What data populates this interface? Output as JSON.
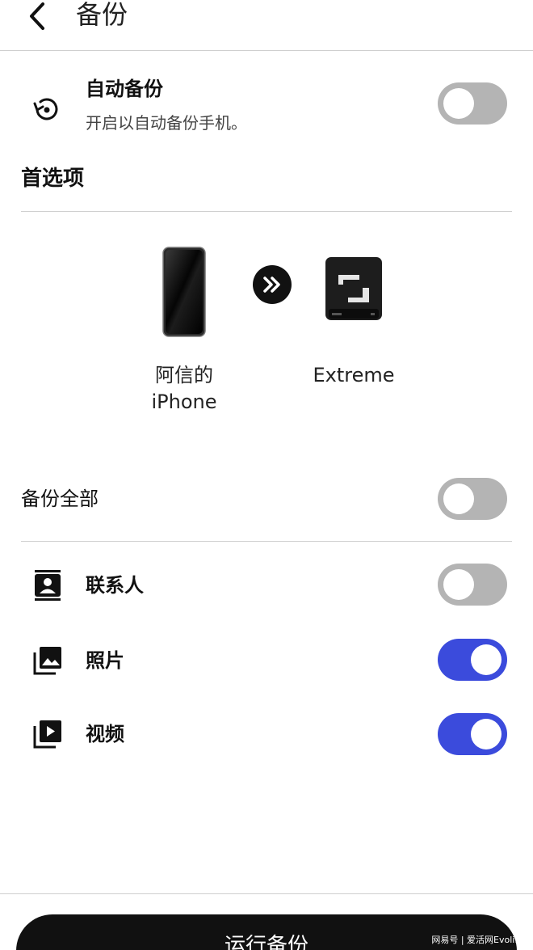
{
  "header": {
    "title": "备份",
    "back_icon": "chevron-left-icon"
  },
  "auto_backup": {
    "icon": "restore-icon",
    "title": "自动备份",
    "subtitle": "开启以自动备份手机。",
    "enabled": false
  },
  "preferences": {
    "title": "首选项",
    "source_device": {
      "icon": "phone-icon",
      "label_line1": "阿信的",
      "label_line2": "iPhone"
    },
    "transfer_icon": "double-chevron-right-icon",
    "target_device": {
      "icon": "ssd-drive-icon",
      "label": "Extreme"
    }
  },
  "backup_all": {
    "label": "备份全部",
    "enabled": false
  },
  "categories": [
    {
      "icon": "contacts-icon",
      "label": "联系人",
      "enabled": false
    },
    {
      "icon": "photos-icon",
      "label": "照片",
      "enabled": true
    },
    {
      "icon": "videos-icon",
      "label": "视频",
      "enabled": true
    }
  ],
  "actions": {
    "run_backup": "运行备份"
  },
  "colors": {
    "toggle_on": "#3b4bdc",
    "toggle_off": "#b4b4b4",
    "button": "#111111"
  },
  "watermark": "网易号 | 爱活网Evolife"
}
